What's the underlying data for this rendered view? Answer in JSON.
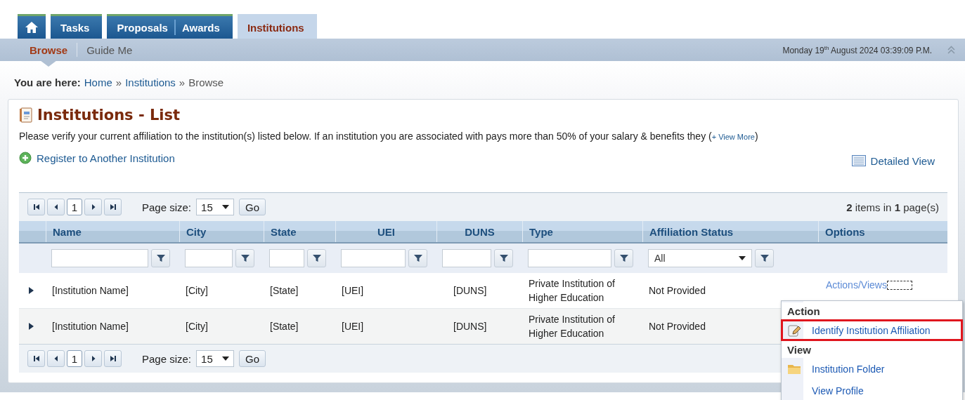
{
  "tabs": [
    {
      "kind": "home",
      "selected": false
    },
    {
      "kind": "text",
      "labels": [
        "Tasks"
      ],
      "selected": false
    },
    {
      "kind": "text",
      "labels": [
        "Proposals",
        "Awards"
      ],
      "selected": false
    },
    {
      "kind": "text",
      "labels": [
        "Institutions"
      ],
      "selected": true
    }
  ],
  "subnav": [
    {
      "label": "Browse",
      "selected": true
    },
    {
      "label": "Guide Me",
      "selected": false
    }
  ],
  "datetime": "Monday 19$^{th}$ August 2024 03:39:09 P.M.",
  "breadcrumb": {
    "label": "You are here:",
    "links": [
      "Home",
      "Institutions"
    ],
    "current": "Browse",
    "separator": "»"
  },
  "panel": {
    "title": "Institutions - List",
    "intro": {
      "text": "Please verify your current affiliation to the institution(s) listed below. If an institution you are associated with pays more than 50% of your salary & benefits they (",
      "link": "+ View More",
      "after": ")"
    },
    "register_link": "Register to Another Institution",
    "detailed_view": "Detailed View"
  },
  "pager_top": {
    "page": "1",
    "page_size_label": "Page size:",
    "page_size": "15",
    "go": "Go",
    "summary": "**2** items in **1** page(s)"
  },
  "columns": [
    {
      "label": "Name",
      "kind": "text"
    },
    {
      "label": "City",
      "kind": "text"
    },
    {
      "label": "State",
      "kind": "text"
    },
    {
      "label": "UEI",
      "kind": "text"
    },
    {
      "label": "DUNS",
      "kind": "text"
    },
    {
      "label": "Type",
      "kind": "text"
    },
    {
      "label": "Affiliation Status",
      "kind": "select",
      "filter_value": "All"
    },
    {
      "label": "Options",
      "kind": "none"
    }
  ],
  "rows": [
    {
      "cells": [
        "[Institution Name]",
        "[City]",
        "[State]",
        "[UEI]",
        "[DUNS]",
        "Private Institution of Higher Education",
        "Not Provided"
      ],
      "options_link": "Actions/Views"
    },
    {
      "cells": [
        "[Institution Name]",
        "[City]",
        "[State]",
        "[UEI]",
        "[DUNS]",
        "Private Institution of Higher Education",
        "Not Provided"
      ]
    }
  ],
  "pager_bottom": {
    "page": "1",
    "page_size_label": "Page size:",
    "page_size": "15",
    "go": "Go"
  },
  "menu": [
    {
      "heading": "Action",
      "items": [
        {
          "label": "Identify Institution Affiliation",
          "highlighted": true
        }
      ]
    },
    {
      "heading": "View",
      "items": [
        {
          "label": "Institution Folder",
          "highlighted": false
        },
        {
          "label": "View Profile",
          "highlighted": false
        }
      ]
    }
  ]
}
